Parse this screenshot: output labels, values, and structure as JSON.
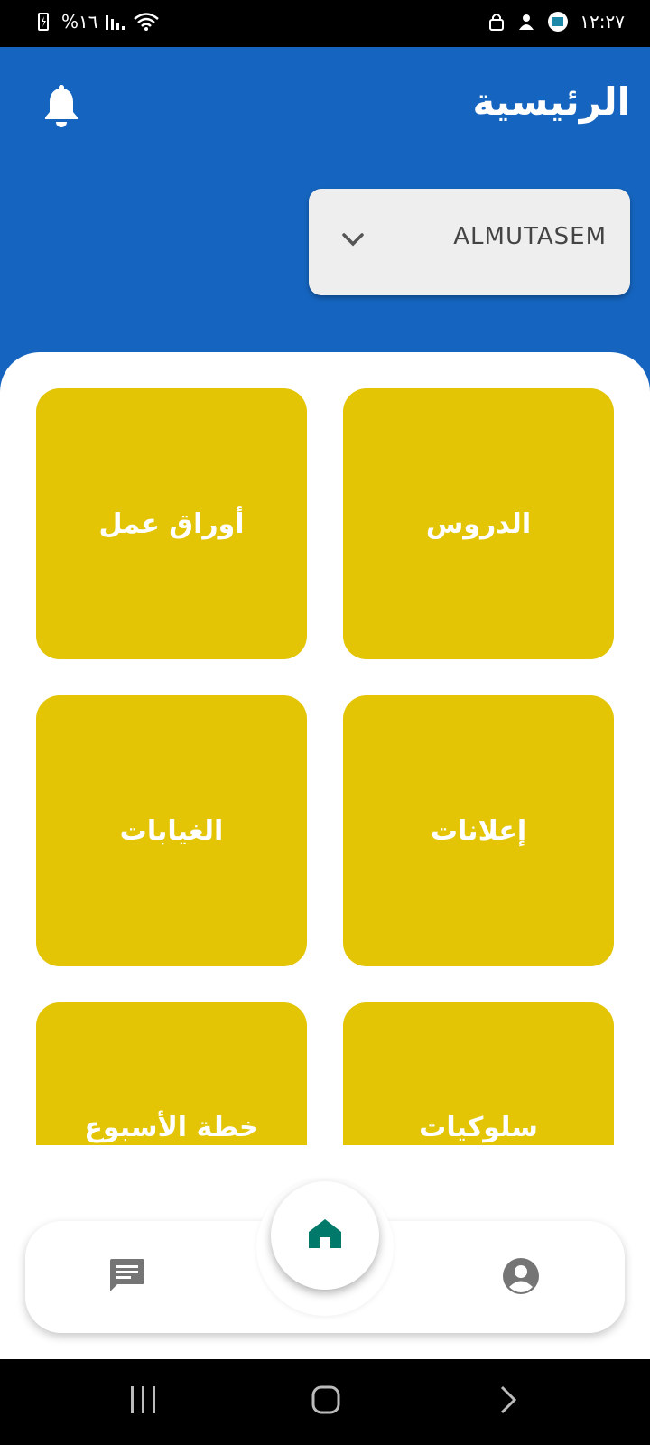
{
  "status_bar": {
    "time": "١٢:٢٧",
    "battery": "%١٦"
  },
  "header": {
    "title": "الرئيسية"
  },
  "account_selector": {
    "selected": "ALMUTASEM"
  },
  "tiles": [
    {
      "label": "الدروس"
    },
    {
      "label": "أوراق عمل"
    },
    {
      "label": "إعلانات"
    },
    {
      "label": "الغيابات"
    },
    {
      "label": "سلوكيات"
    },
    {
      "label": "خطة الأسبوع"
    }
  ],
  "colors": {
    "header_bg": "#1565c0",
    "tile_bg": "#e3c505",
    "home_icon": "#00796b",
    "nav_icon": "#757575"
  },
  "bottom_nav": {
    "items": [
      {
        "icon": "chat-icon"
      },
      {
        "icon": "home-icon"
      },
      {
        "icon": "profile-icon"
      }
    ]
  }
}
